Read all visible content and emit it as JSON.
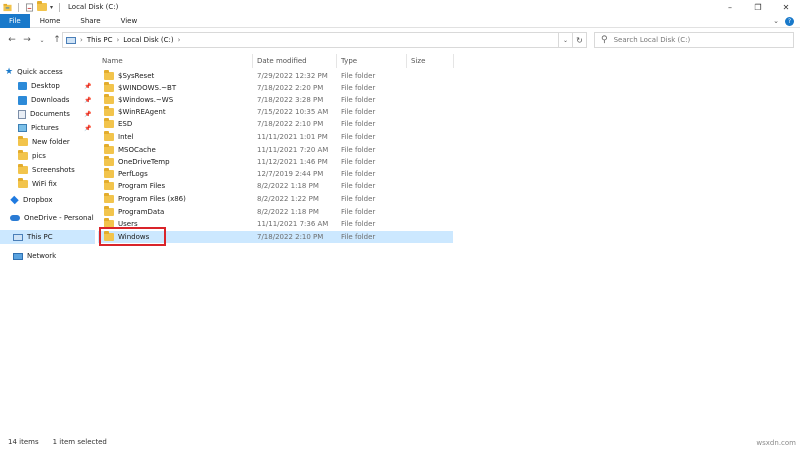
{
  "window": {
    "title": "Local Disk (C:)"
  },
  "ribbon": {
    "tabs": [
      "File",
      "Home",
      "Share",
      "View"
    ]
  },
  "address": {
    "crumbs": [
      "This PC",
      "Local Disk (C:)"
    ]
  },
  "search": {
    "placeholder": "Search Local Disk (C:)"
  },
  "sidebar": {
    "items": [
      {
        "label": "Quick access",
        "icon": "star-icon"
      },
      {
        "label": "Desktop",
        "icon": "desktop-icon",
        "pinned": true
      },
      {
        "label": "Downloads",
        "icon": "downloads-icon",
        "pinned": true
      },
      {
        "label": "Documents",
        "icon": "documents-icon",
        "pinned": true
      },
      {
        "label": "Pictures",
        "icon": "pictures-icon",
        "pinned": true
      },
      {
        "label": "New folder",
        "icon": "folder-icon"
      },
      {
        "label": "pics",
        "icon": "folder-icon"
      },
      {
        "label": "Screenshots",
        "icon": "folder-icon"
      },
      {
        "label": "WiFi fix",
        "icon": "folder-icon"
      },
      {
        "label": "Dropbox",
        "icon": "dropbox-icon"
      },
      {
        "label": "OneDrive - Personal",
        "icon": "onedrive-icon"
      },
      {
        "label": "This PC",
        "icon": "this-pc-icon",
        "selected": true
      },
      {
        "label": "Network",
        "icon": "network-icon"
      }
    ]
  },
  "columns": {
    "name": "Name",
    "date": "Date modified",
    "type": "Type",
    "size": "Size"
  },
  "files": [
    {
      "name": "$SysReset",
      "date": "7/29/2022 12:32 PM",
      "type": "File folder"
    },
    {
      "name": "$WINDOWS.~BT",
      "date": "7/18/2022 2:20 PM",
      "type": "File folder"
    },
    {
      "name": "$Windows.~WS",
      "date": "7/18/2022 3:28 PM",
      "type": "File folder"
    },
    {
      "name": "$WinREAgent",
      "date": "7/15/2022 10:35 AM",
      "type": "File folder"
    },
    {
      "name": "ESD",
      "date": "7/18/2022 2:10 PM",
      "type": "File folder"
    },
    {
      "name": "Intel",
      "date": "11/11/2021 1:01 PM",
      "type": "File folder"
    },
    {
      "name": "MSOCache",
      "date": "11/11/2021 7:20 AM",
      "type": "File folder"
    },
    {
      "name": "OneDriveTemp",
      "date": "11/12/2021 1:46 PM",
      "type": "File folder"
    },
    {
      "name": "PerfLogs",
      "date": "12/7/2019 2:44 PM",
      "type": "File folder"
    },
    {
      "name": "Program Files",
      "date": "8/2/2022 1:18 PM",
      "type": "File folder"
    },
    {
      "name": "Program Files (x86)",
      "date": "8/2/2022 1:22 PM",
      "type": "File folder"
    },
    {
      "name": "ProgramData",
      "date": "8/2/2022 1:18 PM",
      "type": "File folder"
    },
    {
      "name": "Users",
      "date": "11/11/2021 7:36 AM",
      "type": "File folder"
    },
    {
      "name": "Windows",
      "date": "7/18/2022 2:10 PM",
      "type": "File folder",
      "selected": true
    }
  ],
  "status": {
    "count": "14 items",
    "selection": "1 item selected"
  },
  "watermark": "wsxdn.com"
}
